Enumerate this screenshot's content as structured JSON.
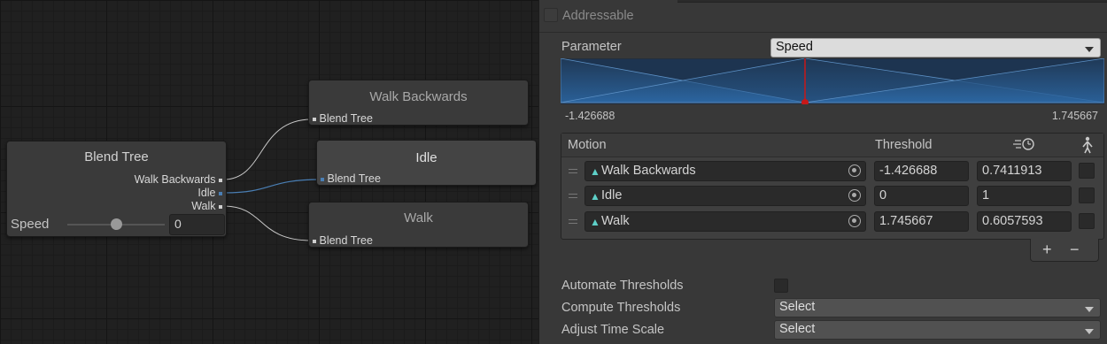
{
  "graph": {
    "blend_node": {
      "title": "Blend Tree",
      "outputs": [
        "Walk Backwards",
        "Idle",
        "Walk"
      ],
      "param_label": "Speed",
      "param_value": "0",
      "slider_fraction": 0.5
    },
    "child_nodes": [
      {
        "title": "Walk Backwards",
        "input": "Blend Tree"
      },
      {
        "title": "Idle",
        "input": "Blend Tree"
      },
      {
        "title": "Walk",
        "input": "Blend Tree"
      }
    ]
  },
  "inspector": {
    "addressable_label": "Addressable",
    "parameter_label": "Parameter",
    "parameter_value": "Speed",
    "range_min": "-1.426688",
    "range_max": "1.745667",
    "motion_header": "Motion",
    "threshold_header": "Threshold",
    "speed_header_icon": "speed-clock-icon",
    "mirror_header_icon": "mirror-figure-icon",
    "motions": [
      {
        "name": "Walk Backwards",
        "threshold": "-1.426688",
        "speed": "0.7411913"
      },
      {
        "name": "Idle",
        "threshold": "0",
        "speed": "1"
      },
      {
        "name": "Walk",
        "threshold": "1.745667",
        "speed": "0.6057593"
      }
    ],
    "add_symbol": "+",
    "remove_symbol": "−",
    "automate_label": "Automate Thresholds",
    "compute_label": "Compute Thresholds",
    "compute_value": "Select",
    "adjust_label": "Adjust Time Scale",
    "adjust_value": "Select"
  },
  "colors": {
    "graph_bg": "#202020",
    "node_bg": "#3a3a3a",
    "wire": "#c8c8c8",
    "wire_selected": "#4a7fb5",
    "accent_blue": "#2f6fb0",
    "marker_red": "#c81818",
    "motion_icon": "#5ed0c8"
  }
}
